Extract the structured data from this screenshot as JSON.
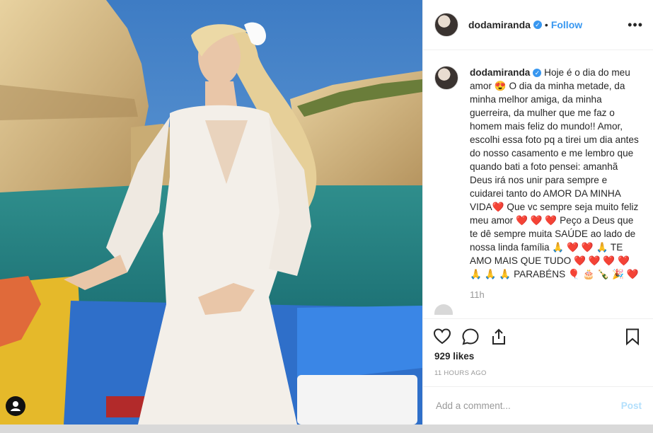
{
  "post": {
    "username": "dodamiranda",
    "follow_label": "Follow",
    "caption_username": "dodamiranda",
    "caption_text": "Hoje é o dia do meu amor 😍 O dia da minha metade, da minha melhor amiga, da minha guerreira, da mulher que me faz o homem mais feliz do mundo!! Amor, escolhi essa foto pq a tirei um dia antes do nosso casamento e me lembro que quando bati a foto pensei: amanhã Deus irá nos unir para sempre e cuidarei tanto do AMOR DA MINHA VIDA❤️ Que vc sempre seja muito feliz meu amor ❤️ ❤️ ❤️ Peço a Deus que te dê sempre muita SAÚDE ao lado de nossa linda família 🙏 ❤️ ❤️ 🙏 TE AMO MAIS QUE TUDO ❤️ ❤️ ❤️ ❤️ 🙏 🙏 🙏 PARABÉNS 🎈 🎂 🍾 🎉 ❤️",
    "time_ago": "11h",
    "likes": "929 likes",
    "timestamp": "11 HOURS AGO",
    "comment_placeholder": "Add a comment...",
    "post_label": "Post"
  },
  "icons": {
    "heart": "heart-icon",
    "comment": "comment-icon",
    "share": "share-icon",
    "bookmark": "bookmark-icon",
    "more": "more-options-icon",
    "tag": "user-tag-icon"
  },
  "colors": {
    "accent": "#3897f0",
    "muted": "#999999"
  }
}
